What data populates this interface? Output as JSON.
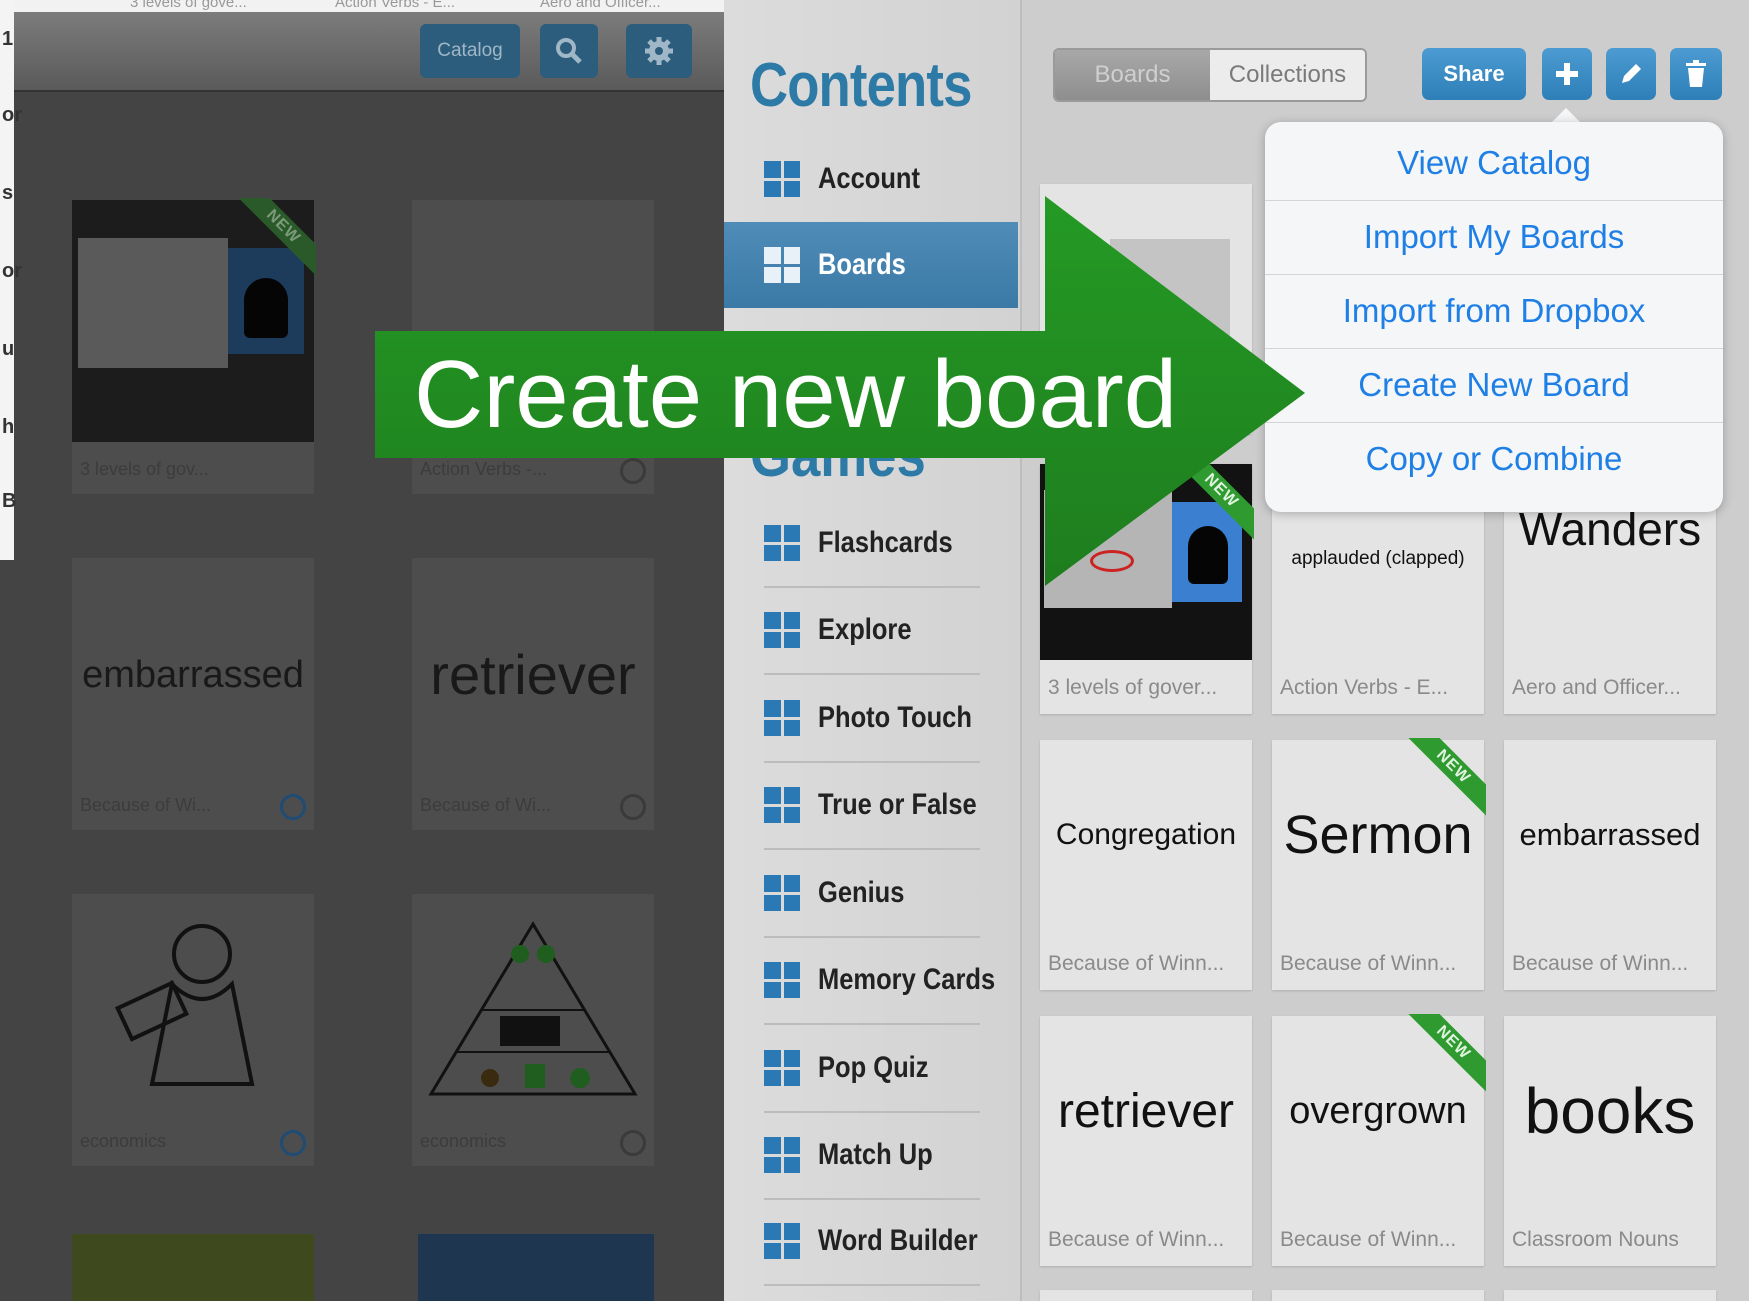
{
  "left_screen": {
    "tabs_partial": [
      "3 levels of gove...",
      "Action Verbs - E...",
      "Aero and Officer..."
    ],
    "toolbar": {
      "catalog_label": "Catalog",
      "search_icon": "search-icon",
      "settings_icon": "gear-icon"
    },
    "edge_letters": [
      "1",
      "or",
      "s",
      "or",
      "u",
      "h",
      "B"
    ],
    "tiles": [
      {
        "caption": "3 levels of gov...",
        "word": "",
        "ribbon": "NEW"
      },
      {
        "caption": "Action Verbs -...",
        "word": ""
      },
      {
        "caption": "Because of Wi...",
        "word": "embarrassed"
      },
      {
        "caption": "Because of Wi...",
        "word": "retriever"
      },
      {
        "caption": "economics",
        "word": ""
      },
      {
        "caption": "economics",
        "word": ""
      }
    ]
  },
  "sidebar": {
    "heading": "Contents",
    "games_heading": "Games",
    "items": [
      {
        "label": "Account"
      },
      {
        "label": "Boards",
        "selected": true
      }
    ],
    "game_items": [
      {
        "label": "Flashcards"
      },
      {
        "label": "Explore"
      },
      {
        "label": "Photo Touch"
      },
      {
        "label": "True or False"
      },
      {
        "label": "Genius"
      },
      {
        "label": "Memory Cards"
      },
      {
        "label": "Pop Quiz"
      },
      {
        "label": "Match Up"
      },
      {
        "label": "Word Builder"
      }
    ]
  },
  "toolbar": {
    "segment": {
      "boards": "Boards",
      "collections": "Collections",
      "active": "Boards"
    },
    "share_label": "Share",
    "add_icon": "plus-icon",
    "edit_icon": "pencil-icon",
    "delete_icon": "trash-icon"
  },
  "popover": {
    "items": [
      "View Catalog",
      "Import My Boards",
      "Import from Dropbox",
      "Create New Board",
      "Copy or Combine"
    ]
  },
  "grid": {
    "rows": [
      [
        {
          "word": "",
          "caption": "3 levels of gover...",
          "ribbon": "NEW"
        },
        {
          "word": "applauded (clapped)",
          "caption": "Action Verbs - E..."
        },
        {
          "word": "Wanders",
          "caption": "Aero and Officer..."
        }
      ],
      [
        {
          "word": "Congregation",
          "caption": "Because of Winn..."
        },
        {
          "word": "Sermon",
          "caption": "Because of Winn...",
          "ribbon": "NEW"
        },
        {
          "word": "embarrassed",
          "caption": "Because of Winn..."
        }
      ],
      [
        {
          "word": "retriever",
          "caption": "Because of Winn..."
        },
        {
          "word": "overgrown",
          "caption": "Because of Winn...",
          "ribbon": "NEW"
        },
        {
          "word": "books",
          "caption": "Classroom Nouns"
        }
      ]
    ]
  },
  "overlay": {
    "label": "Create new board",
    "color": "#2a8a2a"
  },
  "colors": {
    "accent": "#2d7aa6",
    "ios_blue": "#1e7fe6",
    "ribbon_green": "#2f9a2f"
  }
}
